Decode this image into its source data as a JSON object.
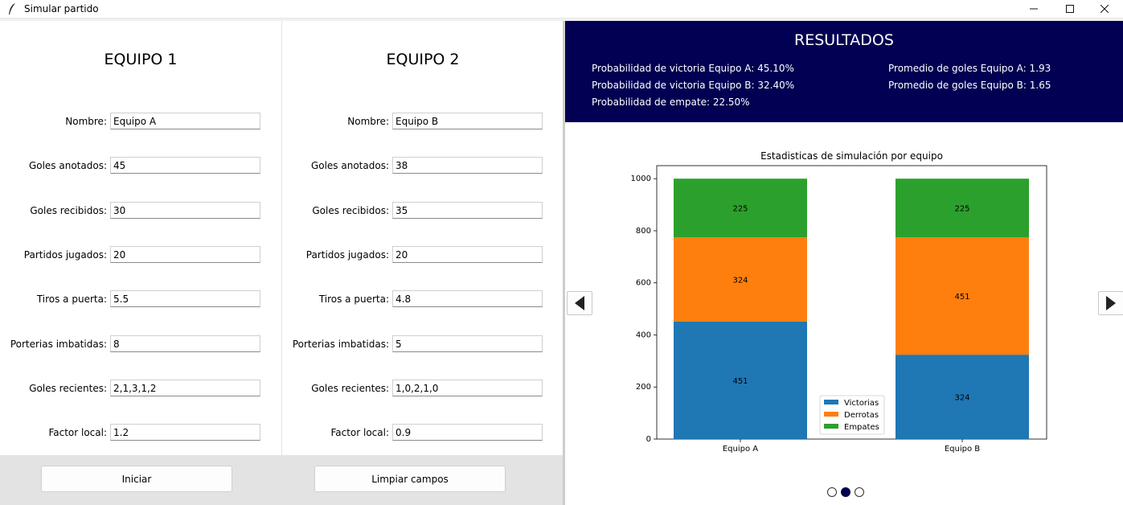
{
  "window": {
    "title": "Simular partido"
  },
  "team1": {
    "title": "EQUIPO 1",
    "fields": [
      {
        "label": "Nombre:",
        "value": "Equipo A"
      },
      {
        "label": "Goles anotados:",
        "value": "45"
      },
      {
        "label": "Goles recibidos:",
        "value": "30"
      },
      {
        "label": "Partidos jugados:",
        "value": "20"
      },
      {
        "label": "Tiros a puerta:",
        "value": "5.5"
      },
      {
        "label": "Porterias imbatidas:",
        "value": "8"
      },
      {
        "label": "Goles recientes:",
        "value": "2,1,3,1,2"
      },
      {
        "label": "Factor local:",
        "value": "1.2"
      }
    ]
  },
  "team2": {
    "title": "EQUIPO 2",
    "fields": [
      {
        "label": "Nombre:",
        "value": "Equipo B"
      },
      {
        "label": "Goles anotados:",
        "value": "38"
      },
      {
        "label": "Goles recibidos:",
        "value": "35"
      },
      {
        "label": "Partidos jugados:",
        "value": "20"
      },
      {
        "label": "Tiros a puerta:",
        "value": "4.8"
      },
      {
        "label": "Porterias imbatidas:",
        "value": "5"
      },
      {
        "label": "Goles recientes:",
        "value": "1,0,2,1,0"
      },
      {
        "label": "Factor local:",
        "value": "0.9"
      }
    ]
  },
  "actions": {
    "start_label": "Iniciar",
    "clear_label": "Limpiar campos"
  },
  "results": {
    "title": "RESULTADOS",
    "win_a": "Probabilidad de victoria Equipo A: 45.10%",
    "win_b": "Probabilidad de victoria Equipo B: 32.40%",
    "draw": "Probabilidad de empate: 22.50%",
    "avg_a": "Promedio de goles Equipo A: 1.93",
    "avg_b": "Promedio de goles Equipo B: 1.65"
  },
  "carousel": {
    "pages": 3,
    "active": 1
  },
  "colors": {
    "results_bg": "#020052",
    "victorias": "#1f77b4",
    "derrotas": "#ff7f0e",
    "empates": "#2ca02c"
  },
  "chart_data": {
    "type": "bar",
    "stacked": true,
    "title": "Estadisticas de simulación por equipo",
    "xlabel": "",
    "ylabel": "",
    "categories": [
      "Equipo A",
      "Equipo B"
    ],
    "series": [
      {
        "name": "Victorias",
        "values": [
          451,
          324
        ],
        "color": "#1f77b4"
      },
      {
        "name": "Derrotas",
        "values": [
          324,
          451
        ],
        "color": "#ff7f0e"
      },
      {
        "name": "Empates",
        "values": [
          225,
          225
        ],
        "color": "#2ca02c"
      }
    ],
    "ylim": [
      0,
      1050
    ],
    "yticks": [
      0,
      200,
      400,
      600,
      800,
      1000
    ],
    "legend_position": "lower-center",
    "grid": false
  }
}
